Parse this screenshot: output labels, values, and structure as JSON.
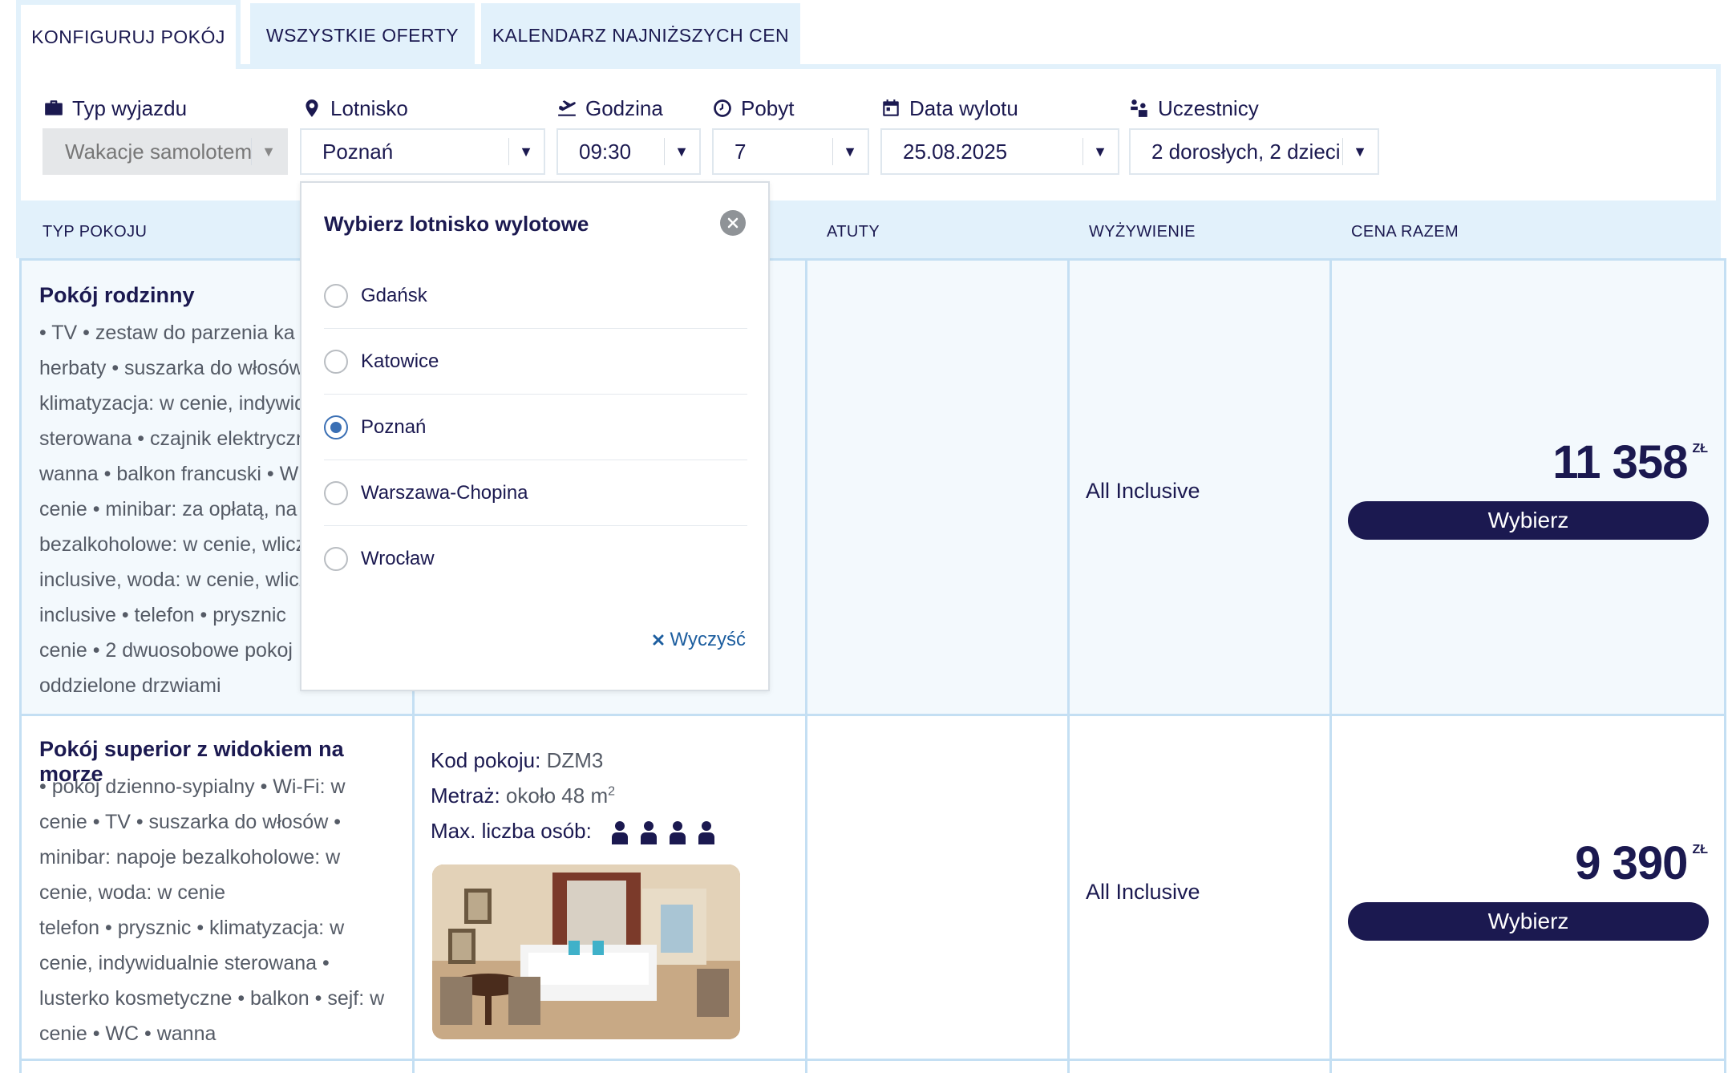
{
  "tabs": [
    {
      "label": "KONFIGURUJ POKÓJ",
      "active": true
    },
    {
      "label": "WSZYSTKIE OFERTY",
      "active": false
    },
    {
      "label": "KALENDARZ NAJNIŻSZYCH CEN",
      "active": false
    }
  ],
  "fields": {
    "trip_type": {
      "label": "Typ wyjazdu",
      "value": "Wakacje samolotem",
      "icon": "briefcase-icon",
      "disabled": true
    },
    "airport": {
      "label": "Lotnisko",
      "value": "Poznań",
      "icon": "map-pin-icon"
    },
    "time": {
      "label": "Godzina",
      "value": "09:30",
      "icon": "plane-takeoff-icon"
    },
    "stay": {
      "label": "Pobyt",
      "value": "7",
      "icon": "clock-icon"
    },
    "departure_date": {
      "label": "Data wylotu",
      "value": "25.08.2025",
      "icon": "calendar-icon"
    },
    "participants": {
      "label": "Uczestnicy",
      "value": "2 dorosłych, 2 dzieci",
      "icon": "people-icon"
    }
  },
  "table": {
    "headers": {
      "room_type": "TYP POKOJU",
      "features": "ATUTY",
      "board": "WYŻYWIENIE",
      "total_price": "CENA RAZEM"
    },
    "rows": [
      {
        "name": "Pokój rodzinny",
        "desc_lines": [
          "• TV • zestaw do parzenia ka",
          "herbaty • suszarka do włosów",
          "klimatyzacja: w cenie, indywid",
          "sterowana • czajnik elektryczn",
          "wanna • balkon francuski • W",
          "cenie • minibar: za opłatą, na",
          "bezalkoholowe: w cenie, wlicz",
          "inclusive, woda: w cenie, wlicz",
          "inclusive • telefon • prysznic",
          "cenie • 2 dwuosobowe pokoj",
          "oddzielone drzwiami"
        ],
        "board": "All Inclusive",
        "price": "11 358",
        "currency": "ZŁ",
        "button": "Wybierz"
      },
      {
        "name": "Pokój superior z widokiem na morze",
        "desc_lines": [
          "• pokój dzienno-sypialny • Wi-Fi: w",
          "cenie • TV • suszarka do włosów •",
          "minibar: napoje bezalkoholowe: w",
          "cenie, woda: w cenie",
          "telefon • prysznic • klimatyzacja: w",
          "cenie, indywidualnie sterowana •",
          "lusterko kosmetyczne • balkon • sejf: w",
          "cenie • WC • wanna"
        ],
        "code_label": "Kod pokoju:",
        "code_value": "DZM3",
        "area_label": "Metraż:",
        "area_value": "około 48 m",
        "area_sup": "2",
        "max_persons_label": "Max. liczba osób:",
        "max_persons": 4,
        "board": "All Inclusive",
        "price": "9 390",
        "currency": "ZŁ",
        "button": "Wybierz"
      }
    ]
  },
  "airport_dropdown": {
    "title": "Wybierz lotnisko wylotowe",
    "options": [
      {
        "label": "Gdańsk",
        "selected": false
      },
      {
        "label": "Katowice",
        "selected": false
      },
      {
        "label": "Poznań",
        "selected": true
      },
      {
        "label": "Warszawa-Chopina",
        "selected": false
      },
      {
        "label": "Wrocław",
        "selected": false
      }
    ],
    "clear_label": "Wyczyść"
  }
}
